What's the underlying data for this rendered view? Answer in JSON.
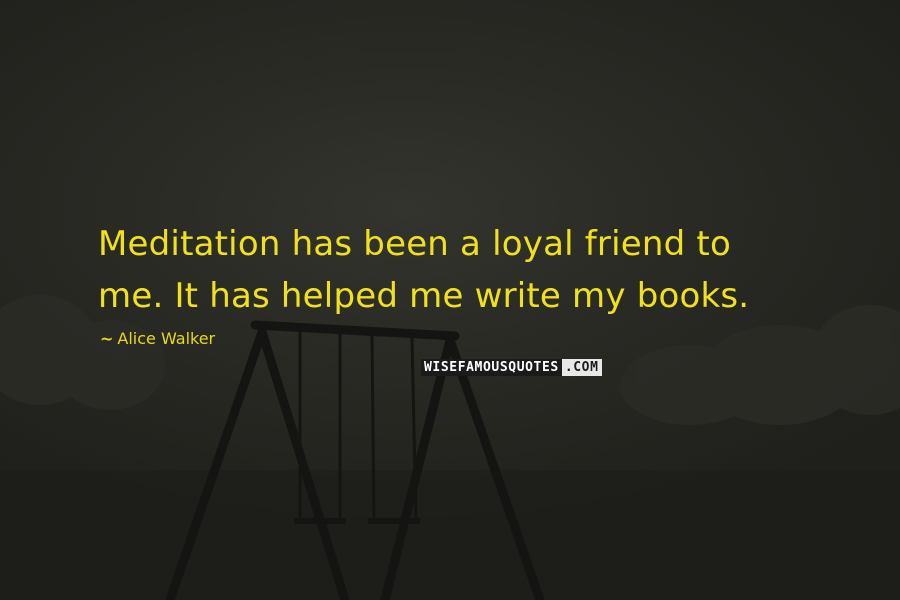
{
  "quote": {
    "lines": [
      "Meditation has been a loyal friend to",
      "me. It has helped me write my books."
    ]
  },
  "author": {
    "prefix": "~",
    "name": "Alice Walker"
  },
  "watermark": {
    "main": "WISEFAMOUSQUOTES",
    "tld": ".COM"
  },
  "colors": {
    "text": "#f1e11d",
    "background": "#2a2a25",
    "swing": "#141412"
  },
  "background_image": {
    "subject": "swing set in fog"
  }
}
